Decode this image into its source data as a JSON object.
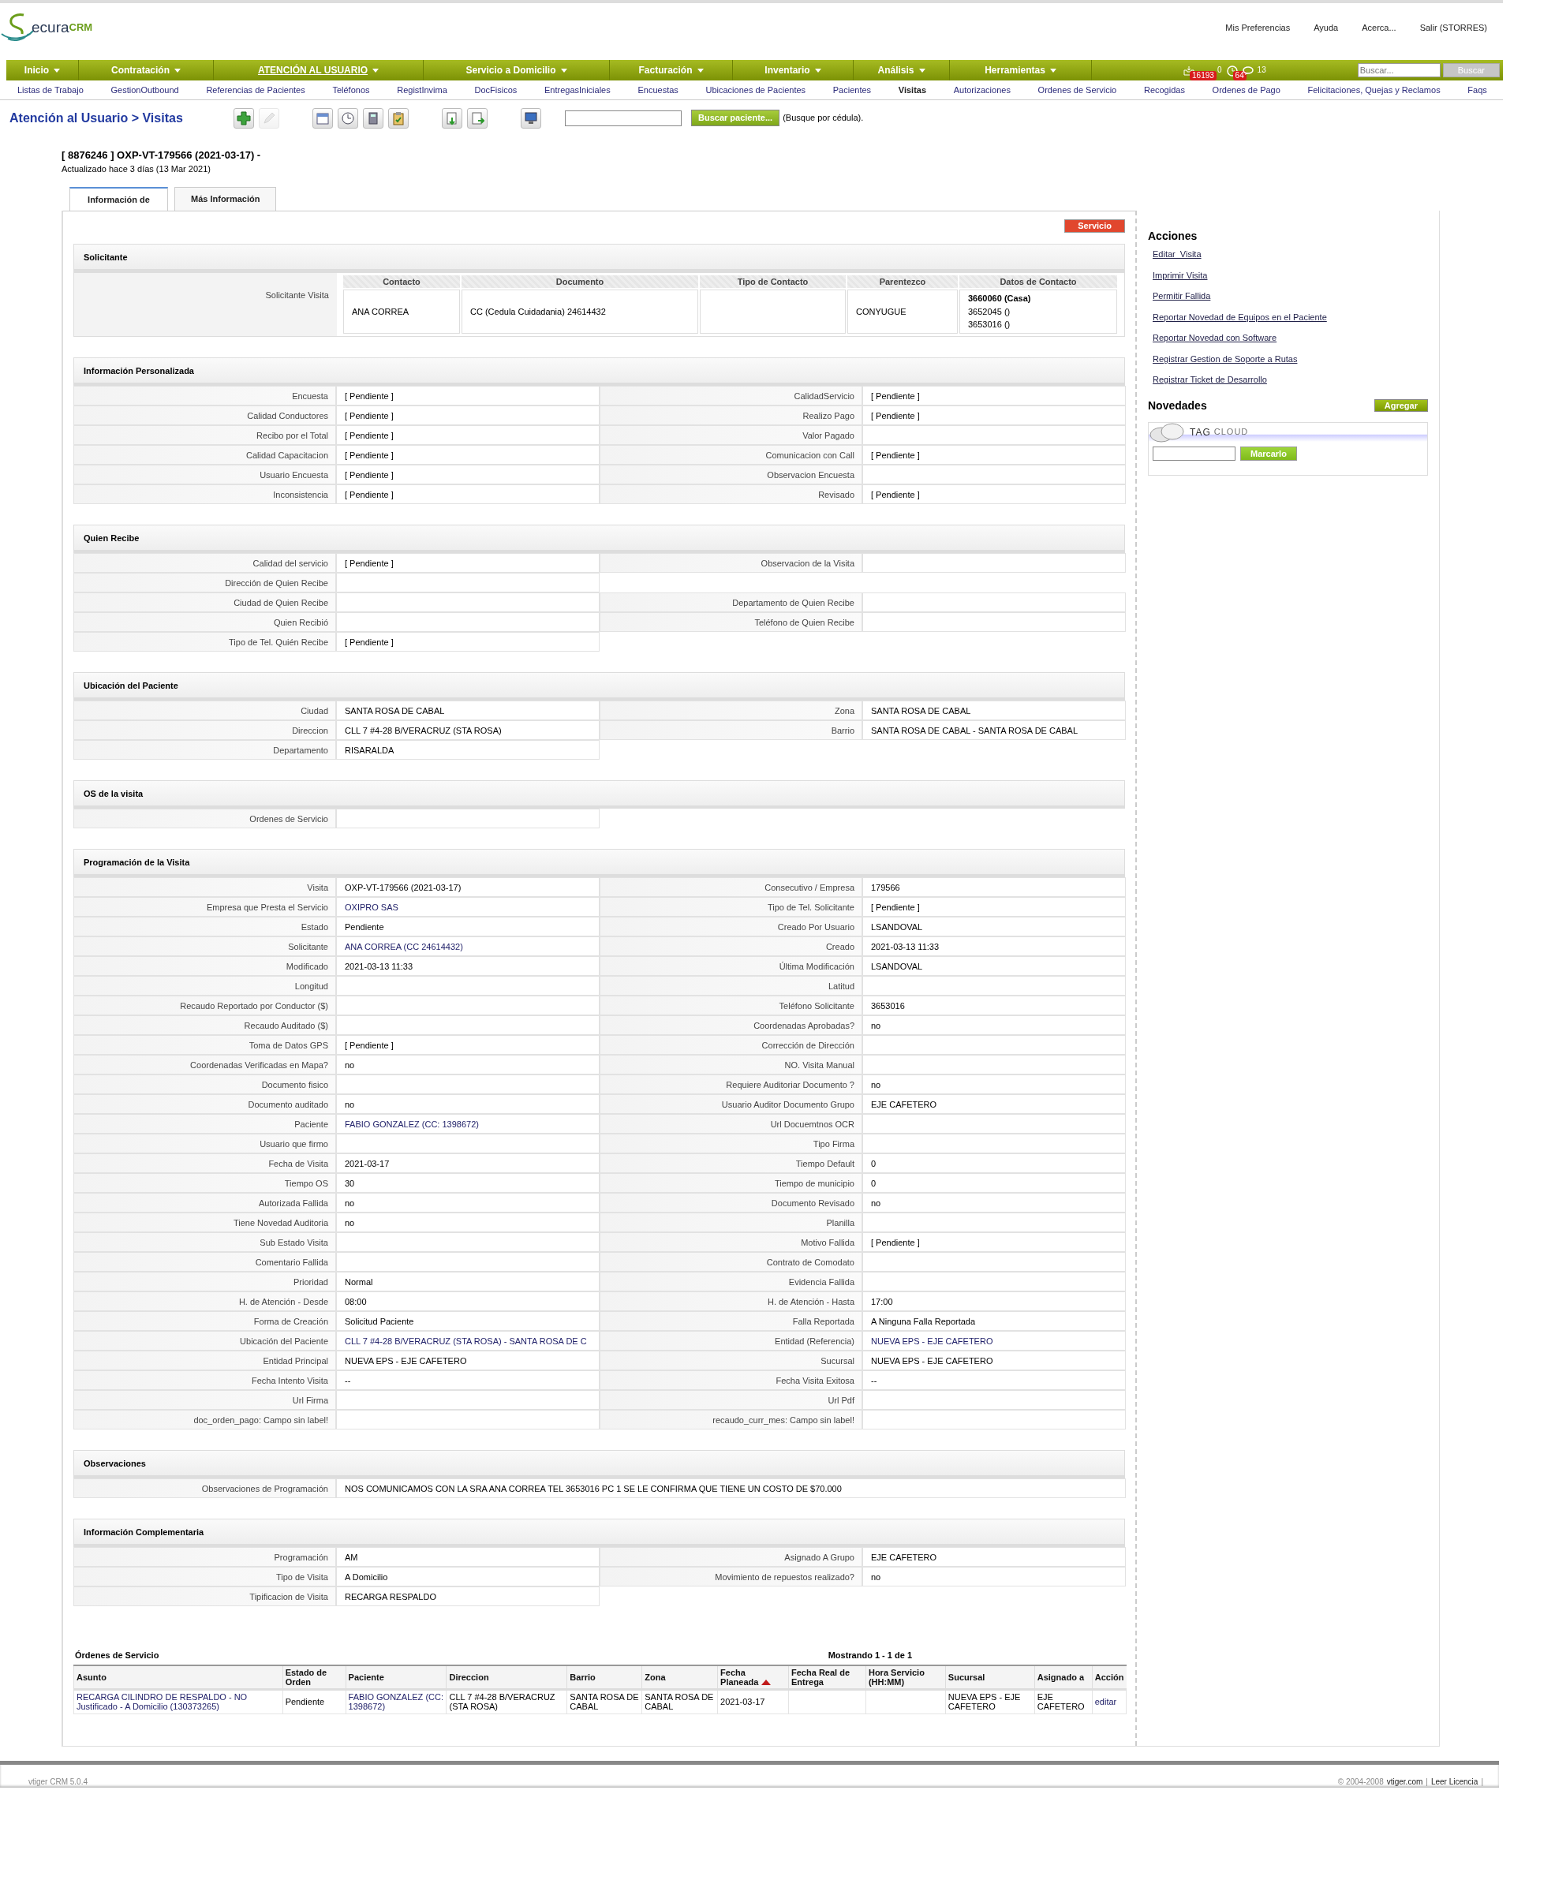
{
  "logo": {
    "text": "ecura",
    "suffix": "CRM"
  },
  "top_links": [
    "Mis Preferencias",
    "Ayuda",
    "Acerca...",
    "Salir (STORRES)"
  ],
  "main_menu": [
    {
      "label": "Inicio",
      "selected": false
    },
    {
      "label": "Contratación",
      "selected": false
    },
    {
      "label": "ATENCIÓN AL USUARIO",
      "selected": true
    },
    {
      "label": "Servicio a Domicilio",
      "selected": false
    },
    {
      "label": "Facturación",
      "selected": false
    },
    {
      "label": "Inventario",
      "selected": false
    },
    {
      "label": "Análisis",
      "selected": false
    },
    {
      "label": "Herramientas",
      "selected": false
    }
  ],
  "notifications": [
    {
      "kind": "inbox",
      "badge": "16193",
      "count": "0"
    },
    {
      "kind": "alarm",
      "badge": "64"
    },
    {
      "kind": "chat",
      "count": "13"
    }
  ],
  "global_search": {
    "placeholder": "Buscar...",
    "button": "Buscar"
  },
  "sub_menu": [
    {
      "label": "Listas de Trabajo",
      "selected": false
    },
    {
      "label": "GestionOutbound",
      "selected": false
    },
    {
      "label": "Referencias de Pacientes",
      "selected": false
    },
    {
      "label": "Teléfonos",
      "selected": false
    },
    {
      "label": "RegistInvima",
      "selected": false
    },
    {
      "label": "DocFisicos",
      "selected": false
    },
    {
      "label": "EntregasIniciales",
      "selected": false
    },
    {
      "label": "Encuestas",
      "selected": false
    },
    {
      "label": "Ubicaciones de Pacientes",
      "selected": false
    },
    {
      "label": "Pacientes",
      "selected": false
    },
    {
      "label": "Visitas",
      "selected": true
    },
    {
      "label": "Autorizaciones",
      "selected": false
    },
    {
      "label": "Ordenes de Servicio",
      "selected": false
    },
    {
      "label": "Recogidas",
      "selected": false
    },
    {
      "label": "Ordenes de Pago",
      "selected": false
    },
    {
      "label": "Felicitaciones, Quejas y Reclamos",
      "selected": false
    },
    {
      "label": "Faqs",
      "selected": false
    }
  ],
  "breadcrumb": "Atención al Usuario > Visitas",
  "toolbar": [
    {
      "kind": "add",
      "disabled": false
    },
    {
      "kind": "edit",
      "disabled": true
    },
    {
      "kind": "calendar",
      "disabled": false
    },
    {
      "kind": "clock",
      "disabled": false
    },
    {
      "kind": "calculator",
      "disabled": false
    },
    {
      "kind": "clipboard",
      "disabled": false
    },
    {
      "kind": "import",
      "disabled": false
    },
    {
      "kind": "export",
      "disabled": false
    },
    {
      "kind": "monitor",
      "disabled": false
    }
  ],
  "patient_search": {
    "button": "Buscar paciente...",
    "hint": "(Busque por cédula)."
  },
  "record": {
    "title": "[ 8876246 ] OXP-VT-179566 (2021-03-17) -",
    "updated": "Actualizado hace 3 días (13 Mar 2021)"
  },
  "tabs": [
    {
      "label": "Información de",
      "selected": true
    },
    {
      "label": "Más Información",
      "selected": false
    }
  ],
  "service_button": "Servicio",
  "solicitante": {
    "title": "Solicitante",
    "label": "Solicitante Visita",
    "columns": [
      "Contacto",
      "Documento",
      "Tipo de Contacto",
      "Parentezco",
      "Datos de Contacto"
    ],
    "contact": "ANA CORREA",
    "document": "CC (Cedula Cuidadania) 24614432",
    "relation": "CONYUGUE",
    "phones": [
      {
        "text": "3660060 (Casa)",
        "primary": true
      },
      {
        "text": "3652045 ()",
        "primary": false
      },
      {
        "text": "3653016 ()",
        "primary": false
      }
    ]
  },
  "sections": [
    {
      "title": "Información Personalizada",
      "wide": false,
      "rows": [
        [
          {
            "label": "Encuesta",
            "value": "[ Pendiente ]"
          },
          {
            "label": "CalidadServicio",
            "value": "[ Pendiente ]"
          }
        ],
        [
          {
            "label": "Calidad Conductores",
            "value": "[ Pendiente ]"
          },
          {
            "label": "Realizo Pago",
            "value": "[ Pendiente ]"
          }
        ],
        [
          {
            "label": "Recibo por el Total",
            "value": "[ Pendiente ]"
          },
          {
            "label": "Valor Pagado"
          }
        ],
        [
          {
            "label": "Calidad Capacitacion",
            "value": "[ Pendiente ]"
          },
          {
            "label": "Comunicacion con Call",
            "value": "[ Pendiente ]"
          }
        ],
        [
          {
            "label": "Usuario Encuesta",
            "value": "[ Pendiente ]"
          },
          {
            "label": "Observacion Encuesta"
          }
        ],
        [
          {
            "label": "Inconsistencia",
            "value": "[ Pendiente ]"
          },
          {
            "label": "Revisado",
            "value": "[ Pendiente ]"
          }
        ]
      ]
    },
    {
      "title": "Quien Recibe",
      "wide": false,
      "rows": [
        [
          {
            "label": "Calidad del servicio",
            "value": "[ Pendiente ]"
          },
          {
            "label": "Observacion de la Visita"
          }
        ],
        [
          {
            "label": "Dirección de Quien Recibe"
          }
        ],
        [
          {
            "label": "Ciudad de Quien Recibe"
          },
          {
            "label": "Departamento de Quien Recibe"
          }
        ],
        [
          {
            "label": "Quien Recibió"
          },
          {
            "label": "Teléfono de Quien Recibe"
          }
        ],
        [
          {
            "label": "Tipo de Tel. Quién Recibe",
            "value": "[ Pendiente ]"
          }
        ]
      ]
    },
    {
      "title": "Ubicación del Paciente",
      "wide": false,
      "rows": [
        [
          {
            "label": "Ciudad",
            "value": "SANTA ROSA DE CABAL"
          },
          {
            "label": "Zona",
            "value": "SANTA ROSA DE CABAL"
          }
        ],
        [
          {
            "label": "Direccion",
            "value": "CLL 7 #4-28 B/VERACRUZ (STA ROSA)"
          },
          {
            "label": "Barrio",
            "value": "SANTA ROSA DE CABAL - SANTA ROSA DE CABAL"
          }
        ],
        [
          {
            "label": "Departamento",
            "value": "RISARALDA"
          }
        ]
      ]
    },
    {
      "title": "OS de la visita",
      "wide": false,
      "rows": [
        [
          {
            "label": "Ordenes de Servicio"
          }
        ]
      ]
    },
    {
      "title": "Programación de la Visita",
      "wide": false,
      "rows": [
        [
          {
            "label": "Visita",
            "value": "OXP-VT-179566 (2021-03-17)"
          },
          {
            "label": "Consecutivo / Empresa",
            "value": "179566"
          }
        ],
        [
          {
            "label": "Empresa que Presta el Servicio",
            "value": "OXIPRO SAS",
            "kind": "link"
          },
          {
            "label": "Tipo de Tel. Solicitante",
            "value": "[ Pendiente ]"
          }
        ],
        [
          {
            "label": "Estado",
            "value": "Pendiente"
          },
          {
            "label": "Creado Por Usuario",
            "value": "LSANDOVAL"
          }
        ],
        [
          {
            "label": "Solicitante",
            "value": "ANA CORREA (CC 24614432)",
            "kind": "link"
          },
          {
            "label": "Creado",
            "value": "2021-03-13 11:33"
          }
        ],
        [
          {
            "label": "Modificado",
            "value": "2021-03-13 11:33"
          },
          {
            "label": "Última Modificación",
            "value": "LSANDOVAL"
          }
        ],
        [
          {
            "label": "Longitud"
          },
          {
            "label": "Latitud"
          }
        ],
        [
          {
            "label": "Recaudo Reportado por Conductor ($)"
          },
          {
            "label": "Teléfono Solicitante",
            "value": "3653016"
          }
        ],
        [
          {
            "label": "Recaudo Auditado ($)"
          },
          {
            "label": "Coordenadas Aprobadas?",
            "value": "no"
          }
        ],
        [
          {
            "label": "Toma de Datos GPS",
            "value": "[ Pendiente ]"
          },
          {
            "label": "Corrección de Dirección"
          }
        ],
        [
          {
            "label": "Coordenadas Verificadas en Mapa?",
            "value": "no"
          },
          {
            "label": "NO. Visita Manual"
          }
        ],
        [
          {
            "label": "Documento fisico"
          },
          {
            "label": "Requiere Auditoriar Documento ?",
            "value": "no"
          }
        ],
        [
          {
            "label": "Documento auditado",
            "value": "no"
          },
          {
            "label": "Usuario Auditor Documento Grupo",
            "value": "EJE CAFETERO"
          }
        ],
        [
          {
            "label": "Paciente",
            "value": "FABIO GONZALEZ (CC: 1398672)",
            "kind": "link"
          },
          {
            "label": "Url Docuemtnos OCR"
          }
        ],
        [
          {
            "label": "Usuario que firmo"
          },
          {
            "label": "Tipo Firma"
          }
        ],
        [
          {
            "label": "Fecha de Visita",
            "value": "2021-03-17"
          },
          {
            "label": "Tiempo Default",
            "value": "0"
          }
        ],
        [
          {
            "label": "Tiempo OS",
            "value": "30"
          },
          {
            "label": "Tiempo de municipio",
            "value": "0"
          }
        ],
        [
          {
            "label": "Autorizada Fallida",
            "value": "no"
          },
          {
            "label": "Documento Revisado",
            "value": "no"
          }
        ],
        [
          {
            "label": "Tiene Novedad Auditoria",
            "value": "no"
          },
          {
            "label": "Planilla"
          }
        ],
        [
          {
            "label": "Sub Estado Visita"
          },
          {
            "label": "Motivo Fallida",
            "value": "[ Pendiente ]"
          }
        ],
        [
          {
            "label": "Comentario Fallida"
          },
          {
            "label": "Contrato de Comodato"
          }
        ],
        [
          {
            "label": "Prioridad",
            "value": "Normal"
          },
          {
            "label": "Evidencia Fallida"
          }
        ],
        [
          {
            "label": "H. de Atención - Desde",
            "value": "08:00"
          },
          {
            "label": "H. de Atención - Hasta",
            "value": "17:00"
          }
        ],
        [
          {
            "label": "Forma de Creación",
            "value": "Solicitud Paciente"
          },
          {
            "label": "Falla Reportada",
            "value": "A Ninguna Falla Reportada"
          }
        ],
        [
          {
            "label": "Ubicación del Paciente",
            "value": "CLL 7 #4-28 B/VERACRUZ (STA ROSA) - SANTA ROSA DE C",
            "kind": "link"
          },
          {
            "label": "Entidad (Referencia)",
            "value": "NUEVA EPS - EJE CAFETERO",
            "kind": "link"
          }
        ],
        [
          {
            "label": "Entidad Principal",
            "value": "NUEVA EPS - EJE CAFETERO"
          },
          {
            "label": "Sucursal",
            "value": "NUEVA EPS - EJE CAFETERO"
          }
        ],
        [
          {
            "label": "Fecha Intento Visita",
            "value": "--"
          },
          {
            "label": "Fecha Visita Exitosa",
            "value": "--"
          }
        ],
        [
          {
            "label": "Url Firma"
          },
          {
            "label": "Url Pdf"
          }
        ],
        [
          {
            "label": "doc_orden_pago: Campo sin label!"
          },
          {
            "label": "recaudo_curr_mes: Campo sin label!"
          }
        ]
      ]
    },
    {
      "title": "Observaciones",
      "wide": true,
      "rows": [
        [
          {
            "label": "Observaciones de Programación",
            "value": "NOS COMUNICAMOS CON LA SRA ANA CORREA TEL 3653016 PC 1 SE LE CONFIRMA QUE TIENE UN COSTO DE $70.000"
          }
        ]
      ]
    },
    {
      "title": "Información Complementaria",
      "wide": false,
      "rows": [
        [
          {
            "label": "Programación",
            "value": "AM"
          },
          {
            "label": "Asignado A Grupo",
            "value": "EJE CAFETERO"
          }
        ],
        [
          {
            "label": "Tipo de Visita",
            "value": "A Domicilio"
          },
          {
            "label": "Movimiento de repuestos realizado?",
            "value": "no"
          }
        ],
        [
          {
            "label": "Tipificacion de Visita",
            "value": "RECARGA RESPALDO"
          }
        ]
      ]
    }
  ],
  "orders": {
    "title": "Órdenes de Servicio",
    "paging": "Mostrando 1 - 1 de 1",
    "columns": [
      {
        "label": "Asunto",
        "sorted": false
      },
      {
        "label": "Estado de Orden",
        "sorted": false
      },
      {
        "label": "Paciente",
        "sorted": false
      },
      {
        "label": "Direccion",
        "sorted": false
      },
      {
        "label": "Barrio",
        "sorted": false
      },
      {
        "label": "Zona",
        "sorted": false
      },
      {
        "label": "Fecha Planeada",
        "sorted": true
      },
      {
        "label": "Fecha Real de Entrega",
        "sorted": false
      },
      {
        "label": "Hora Servicio (HH:MM)",
        "sorted": false
      },
      {
        "label": "Sucursal",
        "sorted": false
      },
      {
        "label": "Asignado a",
        "sorted": false
      },
      {
        "label": "Acción",
        "sorted": false
      }
    ],
    "rows": [
      [
        {
          "text": "RECARGA CILINDRO DE RESPALDO - NO Justificado - A Domicilio (130373265)",
          "kind": "link"
        },
        {
          "text": "Pendiente"
        },
        {
          "text": "FABIO GONZALEZ (CC: 1398672)",
          "kind": "link"
        },
        {
          "text": "CLL 7 #4-28 B/VERACRUZ (STA ROSA)"
        },
        {
          "text": "SANTA ROSA DE CABAL"
        },
        {
          "text": "SANTA ROSA DE CABAL"
        },
        {
          "text": "2021-03-17"
        },
        {},
        {},
        {
          "text": "NUEVA EPS - EJE CAFETERO"
        },
        {
          "text": "EJE CAFETERO"
        },
        {
          "text": "editar",
          "kind": "link"
        }
      ]
    ]
  },
  "sidebar": {
    "actions_title": "Acciones",
    "actions": [
      "Editar  Visita",
      "Imprimir Visita",
      "Permitir Fallida",
      "Reportar Novedad de Equipos en el Paciente",
      "Reportar Novedad con Software",
      "Registrar Gestion de Soporte a Rutas",
      "Registrar Ticket de Desarrollo"
    ],
    "news_title": "Novedades",
    "add_button": "Agregar",
    "tag_cloud": {
      "word1": "TAG",
      "word2": "CLOUD",
      "button": "Marcarlo"
    }
  },
  "footer": {
    "version": "vtiger CRM 5.0.4",
    "copyright": "© 2004-2008",
    "site": "vtiger.com",
    "license": "Leer Licencia",
    "separator": "|"
  }
}
